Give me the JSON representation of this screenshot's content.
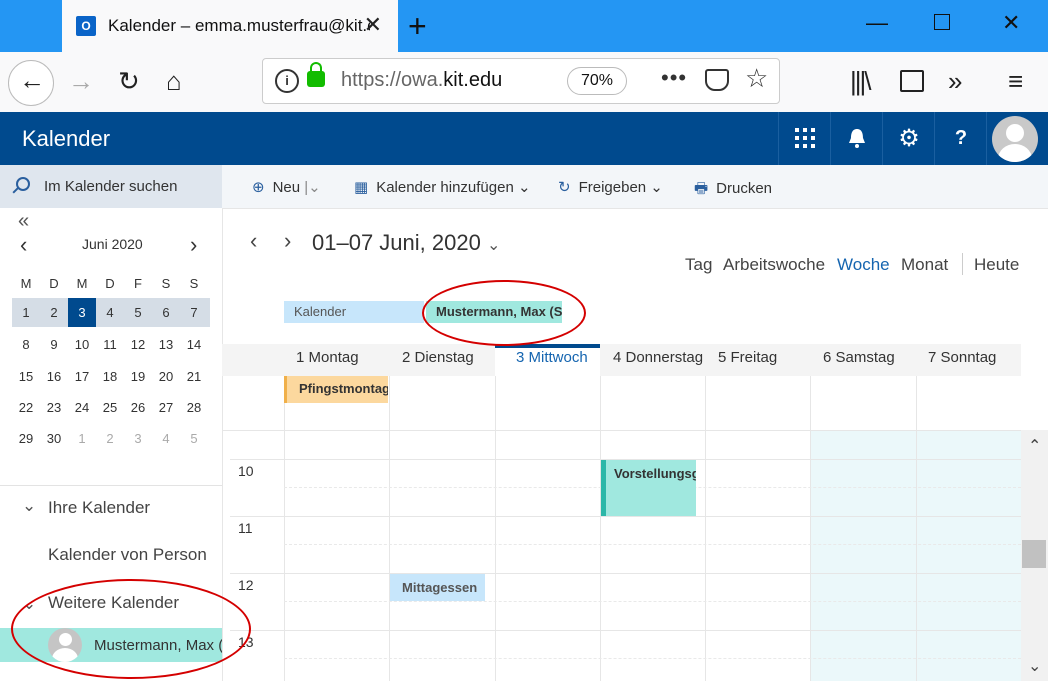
{
  "browser": {
    "tab_title": "Kalender – emma.musterfrau@kit.edu",
    "tab_icon": "O",
    "url_prefix": "https://owa.",
    "url_domain": "kit.edu",
    "zoom": "70%",
    "more": "•••"
  },
  "owa": {
    "app_title": "Kalender",
    "header_icons": [
      "apps-grid-icon",
      "bell-icon",
      "gear-icon",
      "help-icon"
    ],
    "help_label": "?",
    "accent": "#004a8e"
  },
  "search": {
    "label": "Im Kalender suchen"
  },
  "toolbar": {
    "new_label": "Neu",
    "add_calendar_label": "Kalender hinzufügen",
    "share_label": "Freigeben",
    "print_label": "Drucken"
  },
  "mini_calendar": {
    "double_prev": "«",
    "prev": "‹",
    "next": "›",
    "month": "Juni 2020",
    "weekdays": [
      "M",
      "D",
      "M",
      "D",
      "F",
      "S",
      "S"
    ],
    "weeks": [
      [
        "1",
        "2",
        "3",
        "4",
        "5",
        "6",
        "7"
      ],
      [
        "8",
        "9",
        "10",
        "11",
        "12",
        "13",
        "14"
      ],
      [
        "15",
        "16",
        "17",
        "18",
        "19",
        "20",
        "21"
      ],
      [
        "22",
        "23",
        "24",
        "25",
        "26",
        "27",
        "28"
      ],
      [
        "29",
        "30",
        "1",
        "2",
        "3",
        "4",
        "5"
      ]
    ],
    "selected": "3"
  },
  "calendars": {
    "group1": "Ihre Kalender",
    "item1": "Kalender von Personen",
    "group2": "Weitere Kalender",
    "shared": "Mustermann, Max (SCC)"
  },
  "main": {
    "prev": "‹",
    "next": "›",
    "range": "01–07 Juni, 2020",
    "views": [
      "Tag",
      "Arbeitswoche",
      "Woche",
      "Monat"
    ],
    "active_view": "Woche",
    "today": "Heute",
    "cal_chip1": "Kalender",
    "cal_chip2": "Mustermann, Max (SCC)",
    "days": [
      "1 Montag",
      "2 Dienstag",
      "3 Mittwoch",
      "4 Donnerstag",
      "5 Freitag",
      "6 Samstag",
      "7 Sonntag"
    ],
    "hours": [
      "10",
      "11",
      "12",
      "13"
    ],
    "allday_event": "Pfingstmontag",
    "event1": "Vorstellungsgespräch",
    "event2": "Mittagessen"
  }
}
